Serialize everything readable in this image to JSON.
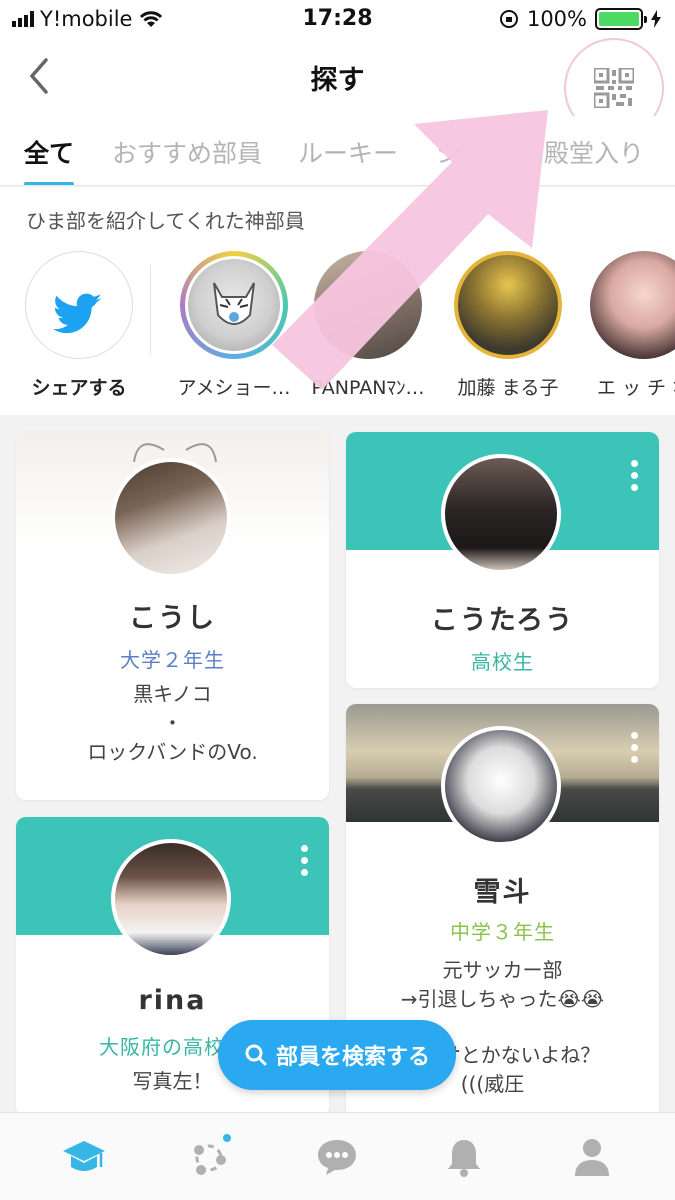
{
  "status": {
    "carrier": "Y!mobile",
    "time": "17:28",
    "battery": "100%"
  },
  "header": {
    "title": "探す"
  },
  "tabs": [
    {
      "label": "全て",
      "active": true
    },
    {
      "label": "おすすめ部員",
      "active": false
    },
    {
      "label": "ルーキー",
      "active": false
    },
    {
      "label": "シ",
      "active": false
    },
    {
      "label": "殿堂入り",
      "active": false
    }
  ],
  "ambassadors": {
    "heading": "ひま部を紹介してくれた神部員",
    "share_label": "シェアする",
    "items": [
      {
        "label": "アメショー…"
      },
      {
        "label": "PANPANﾏﾝ…"
      },
      {
        "label": "加藤 まる子"
      },
      {
        "label": "エ ッ チ な"
      }
    ]
  },
  "cards": [
    {
      "name": "こうし",
      "grade": "大学２年生",
      "bio_line1": "黒キノコ",
      "bio_line2": "・",
      "bio_line3": "ロックバンドのVo."
    },
    {
      "name": "こうたろう",
      "grade": "高校生"
    },
    {
      "name": "雪斗",
      "grade": "中学３年生",
      "bio_line1": "元サッカー部",
      "bio_line2": "→引退しちゃった😭😭",
      "bio_line3": "けとかないよね？",
      "bio_line4": "(((威圧"
    },
    {
      "name": "rina",
      "grade": "大阪府の高校３",
      "bio_line1": "写真左！"
    }
  ],
  "search_button": {
    "label": "部員を検索する"
  },
  "colors": {
    "accent": "#35b6e6",
    "teal": "#3cc4b8",
    "pink_arrow": "#f7c5df",
    "grade_blue": "#5b7ec8",
    "grade_teal": "#3ab5a5",
    "grade_green": "#8bc34a"
  },
  "bottom_nav": [
    "graduation-cap-icon",
    "network-icon",
    "chat-icon",
    "bell-icon",
    "person-icon"
  ]
}
